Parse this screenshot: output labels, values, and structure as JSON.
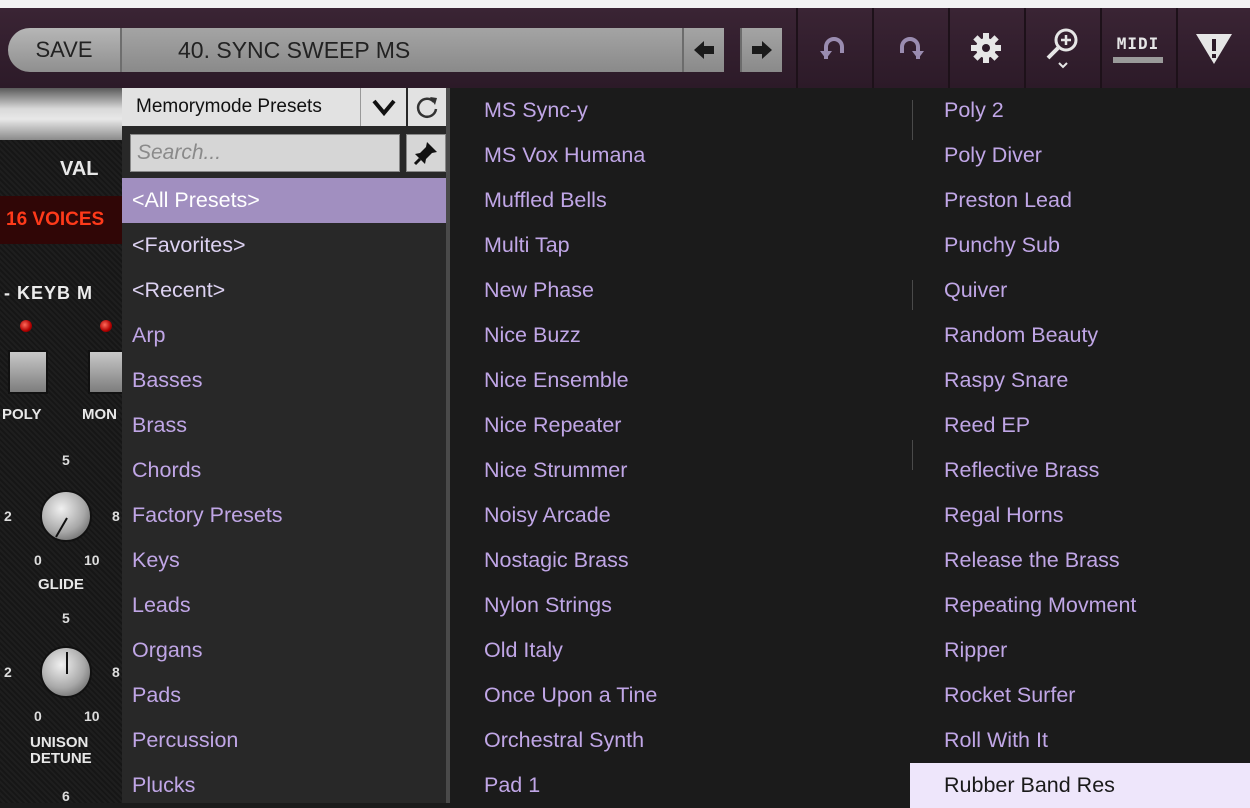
{
  "toolbar": {
    "save_label": "SAVE",
    "preset_name": "40. SYNC SWEEP MS",
    "prev_icon": "arrow-left-icon",
    "next_icon": "arrow-right-icon",
    "undo_icon": "undo-icon",
    "redo_icon": "redo-icon",
    "settings_icon": "gear-icon",
    "zoom_icon": "zoom-icon",
    "midi_label": "MIDI",
    "warning_icon": "warning-icon"
  },
  "synth": {
    "value_label": "VAL",
    "voices_display": "16 VOICES",
    "keyboard_label": "- KEYB M",
    "poly_label": "POLY",
    "mono_label": "MON",
    "glide_label": "GLIDE",
    "unison_label_1": "UNISON",
    "unison_label_2": "DETUNE",
    "tick_5": "5",
    "tick_2": "2",
    "tick_8": "8",
    "tick_0": "0",
    "tick_10": "10",
    "tick_6": "6"
  },
  "browser": {
    "bank_select": "Memorymode Presets",
    "search_placeholder": "Search...",
    "categories": [
      {
        "label": "<All Presets>",
        "special": true,
        "selected": true
      },
      {
        "label": "<Favorites>",
        "special": true
      },
      {
        "label": "<Recent>",
        "special": true
      },
      {
        "label": "Arp"
      },
      {
        "label": "Basses"
      },
      {
        "label": "Brass"
      },
      {
        "label": "Chords"
      },
      {
        "label": "Factory Presets"
      },
      {
        "label": "Keys"
      },
      {
        "label": "Leads"
      },
      {
        "label": "Organs"
      },
      {
        "label": "Pads"
      },
      {
        "label": "Percussion"
      },
      {
        "label": "Plucks"
      }
    ],
    "presets_col1": [
      "MS Sync-y",
      "MS Vox Humana",
      "Muffled Bells",
      "Multi Tap",
      "New Phase",
      "Nice Buzz",
      "Nice Ensemble",
      "Nice Repeater",
      "Nice Strummer",
      "Noisy Arcade",
      "Nostagic Brass",
      "Nylon Strings",
      "Old Italy",
      "Once Upon a Tine",
      "Orchestral Synth",
      "Pad 1"
    ],
    "presets_col2": [
      "Poly 2",
      "Poly Diver",
      "Preston Lead",
      "Punchy Sub",
      "Quiver",
      "Random Beauty",
      "Raspy Snare",
      "Reed EP",
      "Reflective Brass",
      "Regal Horns",
      "Release the Brass",
      "Repeating Movment",
      "Ripper",
      "Rocket Surfer",
      "Roll With It",
      "Rubber Band Res"
    ],
    "selected_preset": "Rubber Band Res"
  }
}
